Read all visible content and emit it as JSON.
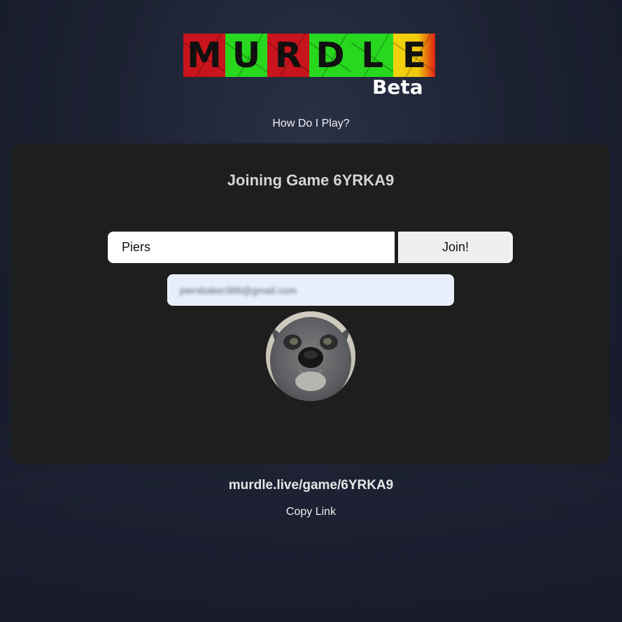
{
  "logo": {
    "letters": [
      "M",
      "U",
      "R",
      "D",
      "L",
      "E"
    ],
    "tile_colors": [
      "#c8141c",
      "#28d81e",
      "#c8141c",
      "#28d81e",
      "#28d81e",
      "#f2d40c"
    ],
    "badge": "Beta"
  },
  "nav": {
    "how_to_play": "How Do I Play?"
  },
  "card": {
    "title": "Joining Game 6YRKA9",
    "name_input_value": "Piers",
    "join_label": "Join!",
    "email_value": "piersbaker386@gmail.com",
    "avatar_icon": "cat-profile-photo"
  },
  "footer": {
    "game_url": "murdle.live/game/6YRKA9",
    "copy_link_label": "Copy Link"
  },
  "colors": {
    "card_background": "#1e1e1e",
    "page_background": "#1d2233",
    "email_field_background": "#e8effb"
  }
}
